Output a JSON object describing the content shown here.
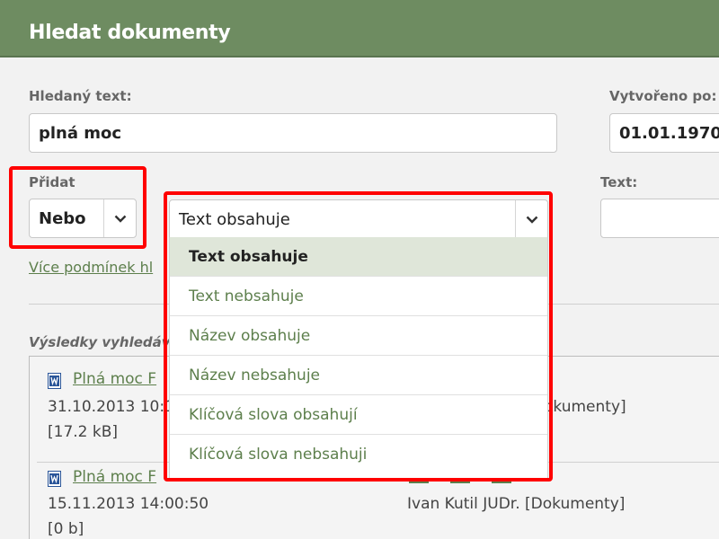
{
  "header": {
    "title": "Hledat dokumenty"
  },
  "form": {
    "search_text_label": "Hledaný text:",
    "search_text_value": "plná moc",
    "created_before_label": "Vytvořeno po:",
    "created_before_value": "01.01.1970",
    "add_label": "Přidat",
    "add_select_value": "Nebo",
    "condition_select_value": "Text obsahuje",
    "text_label": "Text:",
    "text_value": "",
    "more_conditions_link": "Více podmínek hl"
  },
  "dropdown": {
    "options": [
      "Text obsahuje",
      "Text nebsahuje",
      "Název obsahuje",
      "Název nebsahuje",
      "Klíčová slova obsahují",
      "Klíčová slova nebsahuji"
    ],
    "selected_index": 0
  },
  "results": {
    "label": "Výsledky vyhledáv",
    "items": [
      {
        "title": "Plná moc F",
        "date": "31.10.2013 10:1",
        "size": "[17.2 kB]",
        "author": "okumenty]"
      },
      {
        "title": "Plná moc F",
        "date": "15.11.2013 14:00:50",
        "size": "[0 b]",
        "author": "Ivan Kutil JUDr. [Dokumenty]"
      }
    ]
  },
  "colors": {
    "header_bg": "#6e8c61",
    "link": "#5d7f4c",
    "highlight": "#ff0000",
    "selected_option_bg": "#dfe6d9"
  }
}
